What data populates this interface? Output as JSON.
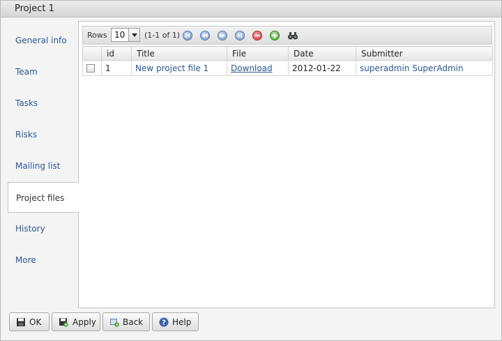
{
  "window": {
    "title": "Project 1"
  },
  "tabs": [
    {
      "label": "General info"
    },
    {
      "label": "Team"
    },
    {
      "label": "Tasks"
    },
    {
      "label": "Risks"
    },
    {
      "label": "Mailing list"
    },
    {
      "label": "Project files",
      "active": true
    },
    {
      "label": "History"
    },
    {
      "label": "More"
    }
  ],
  "toolbar": {
    "rows_label": "Rows",
    "rows_value": "10",
    "pager_info": "(1-1 of 1)",
    "icons": [
      "first-page-icon",
      "prev-page-icon",
      "next-page-icon",
      "last-page-icon",
      "delete-icon",
      "add-icon",
      "search-icon"
    ]
  },
  "grid": {
    "columns": [
      "",
      "id",
      "Title",
      "File",
      "Date",
      "Submitter"
    ],
    "rows": [
      {
        "id": "1",
        "title": "New project file 1",
        "file": "Download",
        "date": "2012-01-22",
        "submitter": "superadmin SuperAdmin"
      }
    ]
  },
  "buttons": {
    "ok": "OK",
    "apply": "Apply",
    "back": "Back",
    "help": "Help"
  },
  "colors": {
    "link": "#2b5796",
    "delete": "#d13b3b",
    "add": "#43a82b",
    "nav": "#6f93c6"
  }
}
